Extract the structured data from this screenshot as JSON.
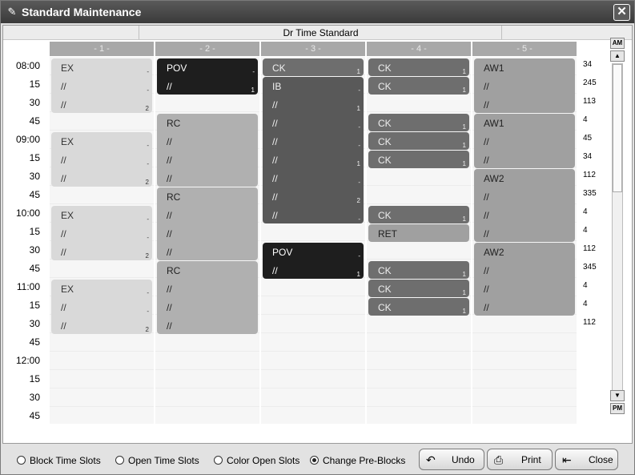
{
  "window": {
    "title": "Standard Maintenance",
    "close_glyph": "✕",
    "title_icon": "pencil-icon"
  },
  "schedule": {
    "name": "Dr Time Standard",
    "columns": [
      "- 1 -",
      "- 2 -",
      "- 3 -",
      "- 4 -",
      "- 5 -"
    ],
    "times": [
      "08:00",
      "15",
      "30",
      "45",
      "09:00",
      "15",
      "30",
      "45",
      "10:00",
      "15",
      "30",
      "45",
      "11:00",
      "15",
      "30",
      "45",
      "12:00",
      "15",
      "30",
      "45"
    ],
    "counts": [
      "34",
      "245",
      "113",
      "4",
      "45",
      "34",
      "112",
      "335",
      "4",
      "4",
      "112",
      "345",
      "4",
      "4",
      "112"
    ],
    "blocks": {
      "c1": [
        {
          "lines": [
            "EX",
            "//",
            "//"
          ],
          "marks": [
            "-",
            "-",
            "2"
          ]
        },
        {
          "lines": [
            "EX",
            "//",
            "//"
          ],
          "marks": [
            "-",
            "-",
            "2"
          ]
        },
        {
          "lines": [
            "EX",
            "//",
            "//"
          ],
          "marks": [
            "-",
            "-",
            "2"
          ]
        },
        {
          "lines": [
            "EX",
            "//",
            "//"
          ],
          "marks": [
            "-",
            "-",
            "2"
          ]
        }
      ],
      "c2": [
        {
          "lines": [
            "POV",
            "//"
          ],
          "marks": [
            "-",
            "1"
          ]
        },
        {
          "lines": [
            "RC",
            "//",
            "//",
            "//"
          ]
        },
        {
          "lines": [
            "RC",
            "//",
            "//",
            "//"
          ]
        },
        {
          "lines": [
            "RC",
            "//",
            "//",
            "//"
          ]
        }
      ],
      "c3": [
        {
          "lines": [
            "CK"
          ],
          "marks": [
            "1"
          ]
        },
        {
          "lines": [
            "IB",
            "//",
            "//",
            "//",
            "//",
            "//",
            "//",
            "//"
          ],
          "marks": [
            "-",
            "1",
            "-",
            "-",
            "1",
            "-",
            "2",
            "-"
          ]
        },
        {
          "lines": [
            "POV",
            "//"
          ],
          "marks": [
            "-",
            "1"
          ]
        }
      ],
      "c4": [
        {
          "lines": [
            "CK"
          ],
          "marks": [
            "1"
          ]
        },
        {
          "lines": [
            "CK"
          ],
          "marks": [
            "1"
          ]
        },
        {
          "lines": [
            "CK"
          ],
          "marks": [
            "1"
          ]
        },
        {
          "lines": [
            "CK"
          ],
          "marks": [
            "1"
          ]
        },
        {
          "lines": [
            "CK"
          ],
          "marks": [
            "1"
          ]
        },
        {
          "lines": [
            "CK"
          ],
          "marks": [
            "1"
          ]
        },
        {
          "lines": [
            "RET"
          ]
        },
        {
          "lines": [
            "CK"
          ],
          "marks": [
            "1"
          ]
        },
        {
          "lines": [
            "CK"
          ],
          "marks": [
            "1"
          ]
        },
        {
          "lines": [
            "CK"
          ],
          "marks": [
            "1"
          ]
        }
      ],
      "c5": [
        {
          "lines": [
            "AW1",
            "//",
            "//"
          ]
        },
        {
          "lines": [
            "AW1",
            "//",
            "//"
          ]
        },
        {
          "lines": [
            "AW2",
            "//",
            "//",
            "//"
          ]
        },
        {
          "lines": [
            "AW2",
            "//",
            "//",
            "//"
          ]
        }
      ]
    }
  },
  "scroll": {
    "am": "AM",
    "pm": "PM"
  },
  "footer": {
    "options": [
      {
        "label": "Block Time Slots",
        "selected": false
      },
      {
        "label": "Open Time Slots",
        "selected": false
      },
      {
        "label": "Color Open Slots",
        "selected": false
      },
      {
        "label": "Change Pre-Blocks",
        "selected": true
      }
    ],
    "buttons": {
      "undo": "Undo",
      "print": "Print",
      "close": "Close"
    }
  }
}
